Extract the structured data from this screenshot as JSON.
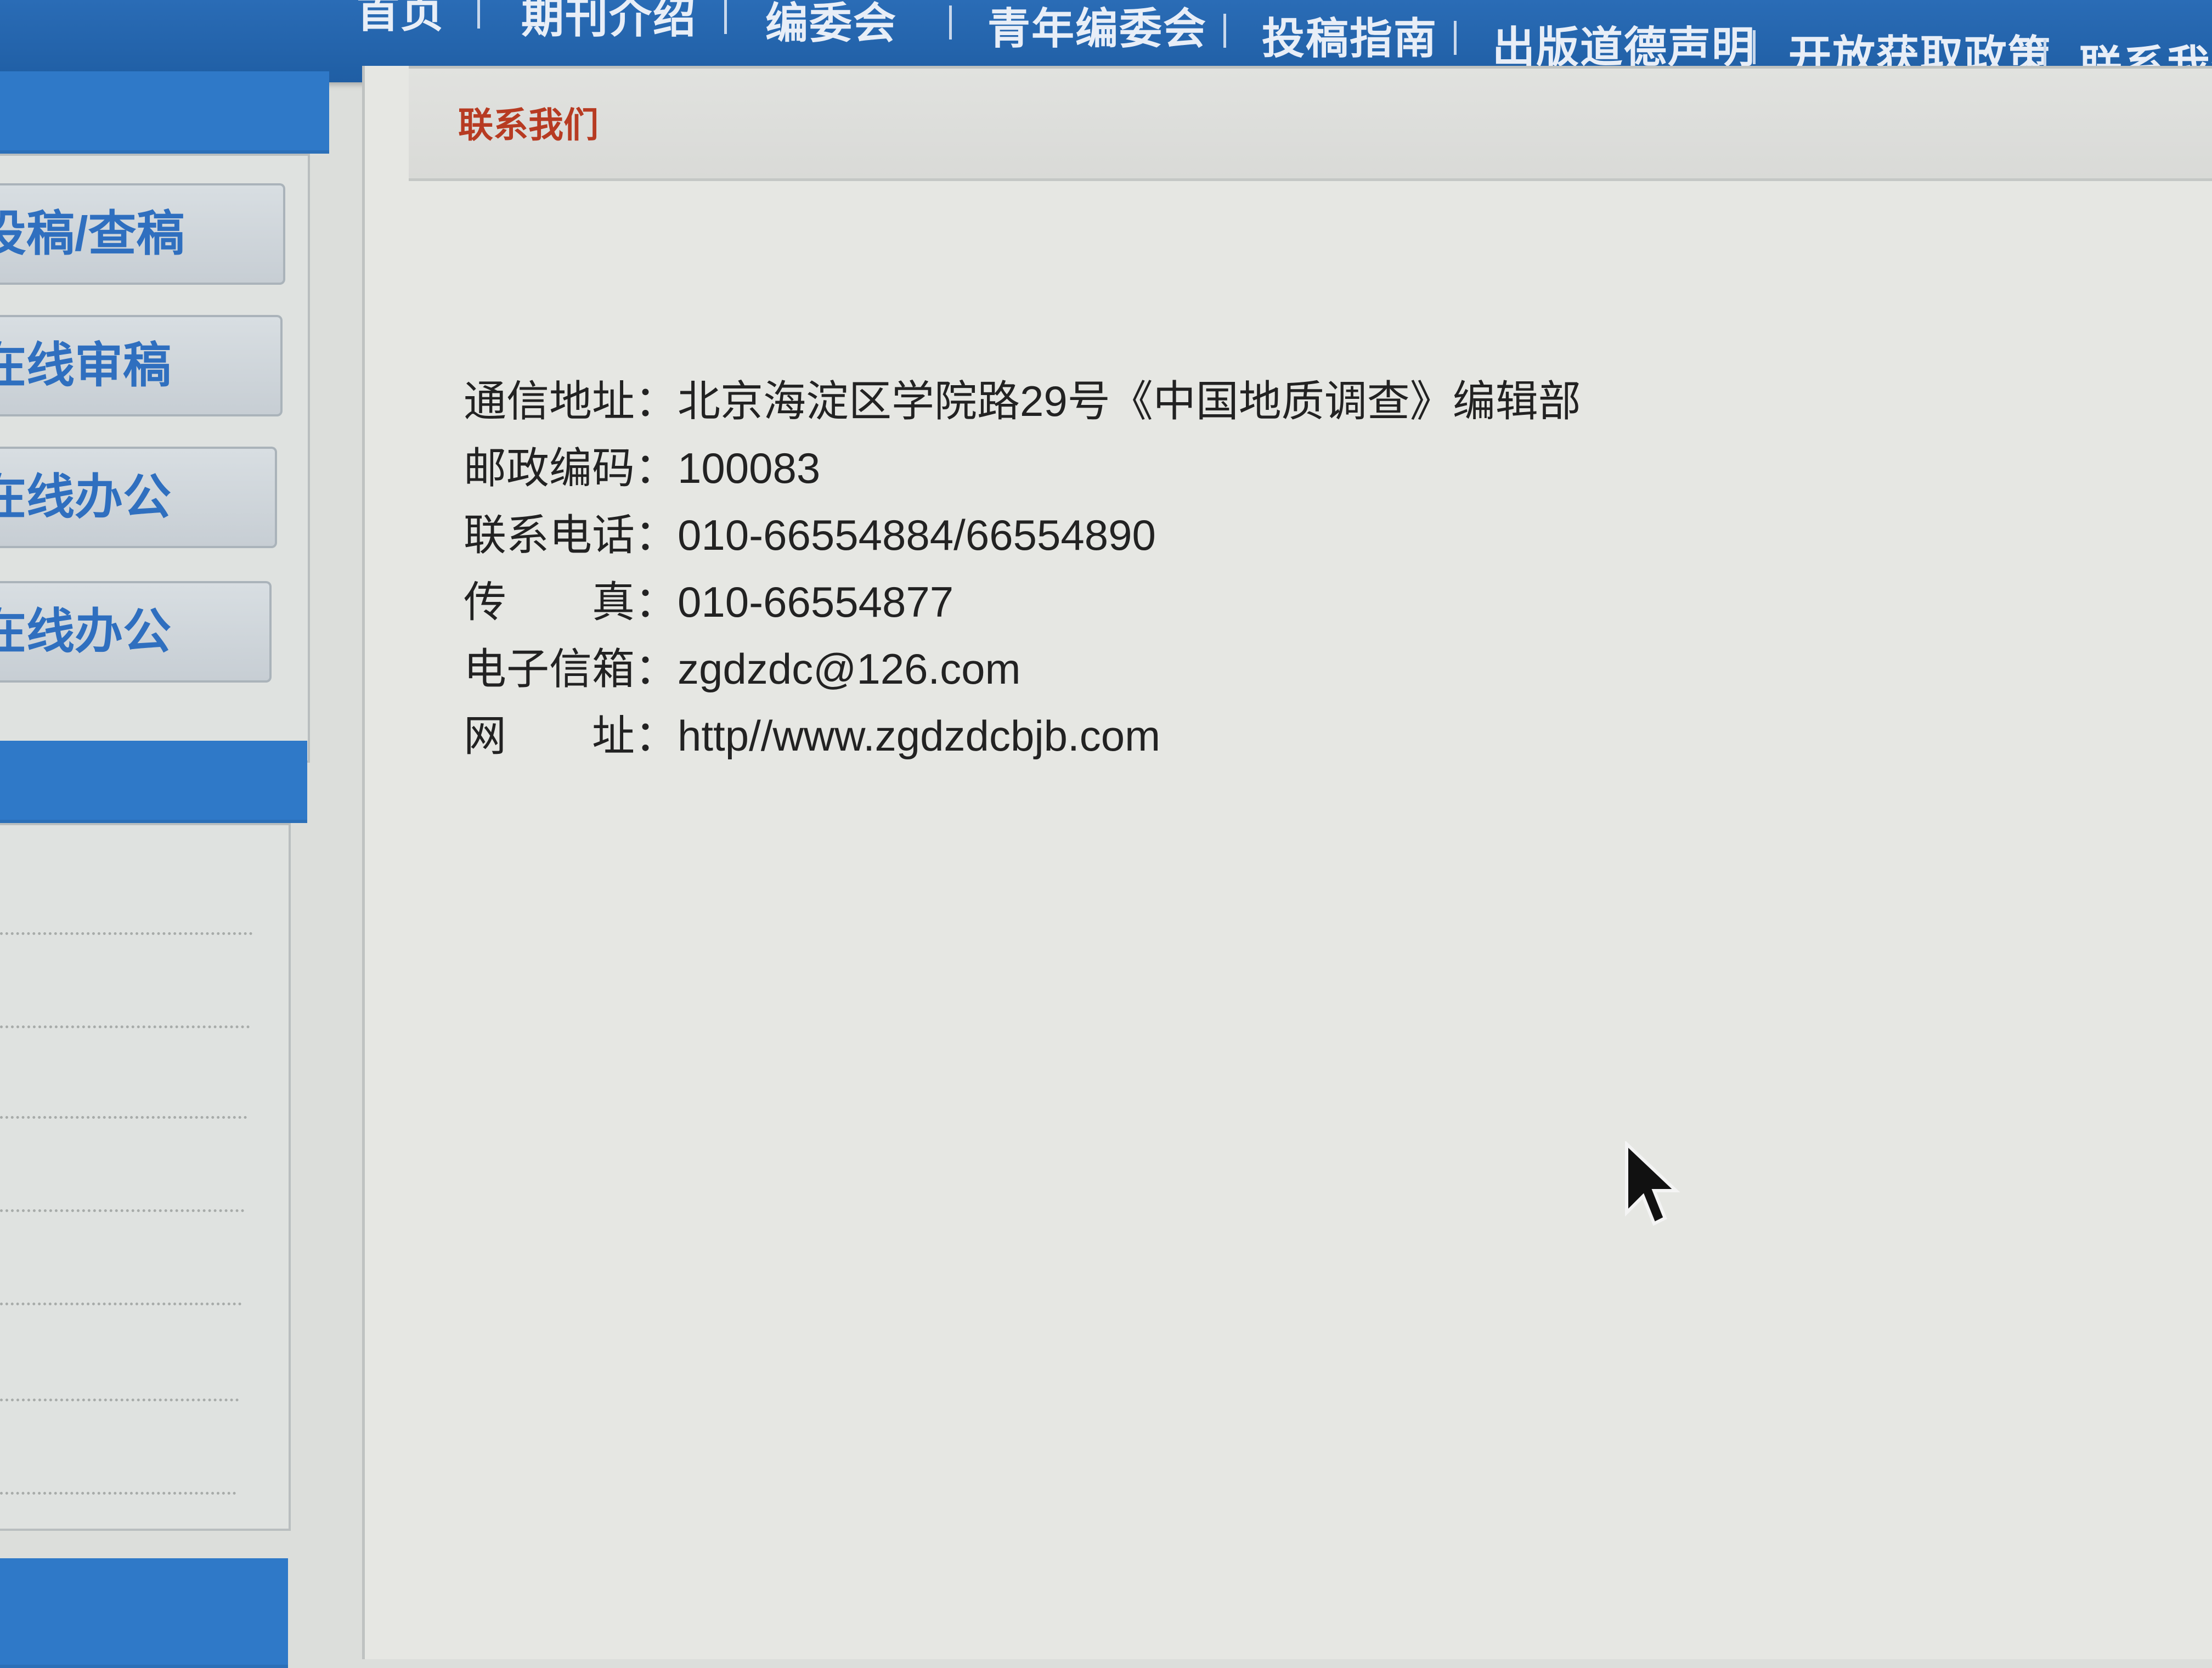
{
  "topnav": {
    "items": [
      {
        "label": "首页"
      },
      {
        "label": "期刊介绍"
      },
      {
        "label": "编委会"
      },
      {
        "label": "青年编委会"
      },
      {
        "label": "投稿指南"
      },
      {
        "label": "出版道德声明"
      },
      {
        "label": "开放获取政策"
      },
      {
        "label": "联系我们"
      }
    ]
  },
  "sidebar": {
    "buttons": [
      {
        "label": "投稿/查稿"
      },
      {
        "label": "在线审稿"
      },
      {
        "label": "在线办公"
      },
      {
        "label": "在线办公"
      }
    ]
  },
  "main": {
    "title": "联系我们",
    "contact": [
      {
        "label": "通信地址：",
        "value": "北京海淀区学院路29号《中国地质调查》编辑部"
      },
      {
        "label": "邮政编码：",
        "value": "100083"
      },
      {
        "label": "联系电话：",
        "value": "010-66554884/66554890"
      },
      {
        "label": "传　　真：",
        "value": "010-66554877"
      },
      {
        "label": "电子信箱：",
        "value": "zgdzdc@126.com"
      },
      {
        "label": "网　　址：",
        "value": "http//www.zgdzdcbjb.com"
      }
    ]
  },
  "colors": {
    "nav_blue": "#2a6cb6",
    "sidebar_header_blue": "#2f79c8",
    "title_red": "#b73b22"
  },
  "icons": {
    "cursor": "mouse-pointer-icon"
  }
}
